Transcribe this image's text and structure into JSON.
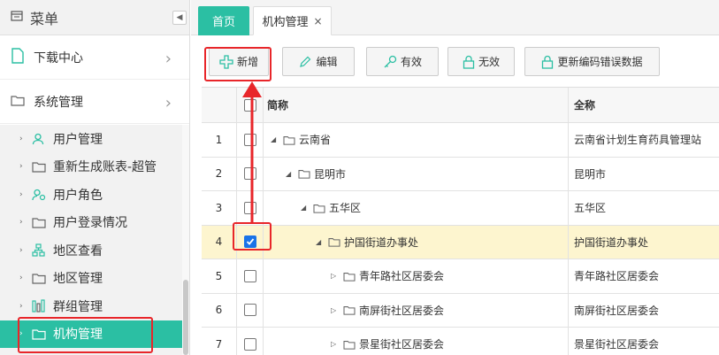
{
  "sidebar": {
    "title": "菜单",
    "top_items": [
      {
        "label": "下载中心",
        "icon": "file-icon"
      },
      {
        "label": "系统管理",
        "icon": "folder-icon"
      }
    ],
    "sub_items": [
      {
        "label": "用户管理",
        "icon": "user-icon"
      },
      {
        "label": "重新生成账表-超管",
        "icon": "folder-icon"
      },
      {
        "label": "用户角色",
        "icon": "user-role-icon"
      },
      {
        "label": "用户登录情况",
        "icon": "folder-icon"
      },
      {
        "label": "地区查看",
        "icon": "sitemap-icon"
      },
      {
        "label": "地区管理",
        "icon": "folder-icon"
      },
      {
        "label": "群组管理",
        "icon": "group-icon"
      },
      {
        "label": "机构管理",
        "icon": "folder-icon",
        "active": true
      }
    ]
  },
  "tabs": [
    {
      "label": "首页"
    },
    {
      "label": "机构管理",
      "close": "×"
    }
  ],
  "toolbar": {
    "add": "新增",
    "edit": "编辑",
    "valid": "有效",
    "invalid": "无效",
    "update": "更新编码错误数据"
  },
  "grid": {
    "headers": {
      "name": "简称",
      "full": "全称"
    },
    "rows": [
      {
        "num": "1",
        "name": "云南省",
        "full": "云南省计划生育药具管理站",
        "level": 0,
        "expanded": true
      },
      {
        "num": "2",
        "name": "昆明市",
        "full": "昆明市",
        "level": 1,
        "expanded": true
      },
      {
        "num": "3",
        "name": "五华区",
        "full": "五华区",
        "level": 2,
        "expanded": true
      },
      {
        "num": "4",
        "name": "护国街道办事处",
        "full": "护国街道办事处",
        "level": 3,
        "expanded": true,
        "selected": true
      },
      {
        "num": "5",
        "name": "青年路社区居委会",
        "full": "青年路社区居委会",
        "level": 4,
        "expanded": false
      },
      {
        "num": "6",
        "name": "南屏街社区居委会",
        "full": "南屏街社区居委会",
        "level": 4,
        "expanded": false
      },
      {
        "num": "7",
        "name": "景星街社区居委会",
        "full": "景星街社区居委会",
        "level": 4,
        "expanded": false
      }
    ]
  },
  "colors": {
    "accent": "#2bbfa3",
    "highlight": "#e8262a",
    "selected_row": "#fdf5cf"
  }
}
